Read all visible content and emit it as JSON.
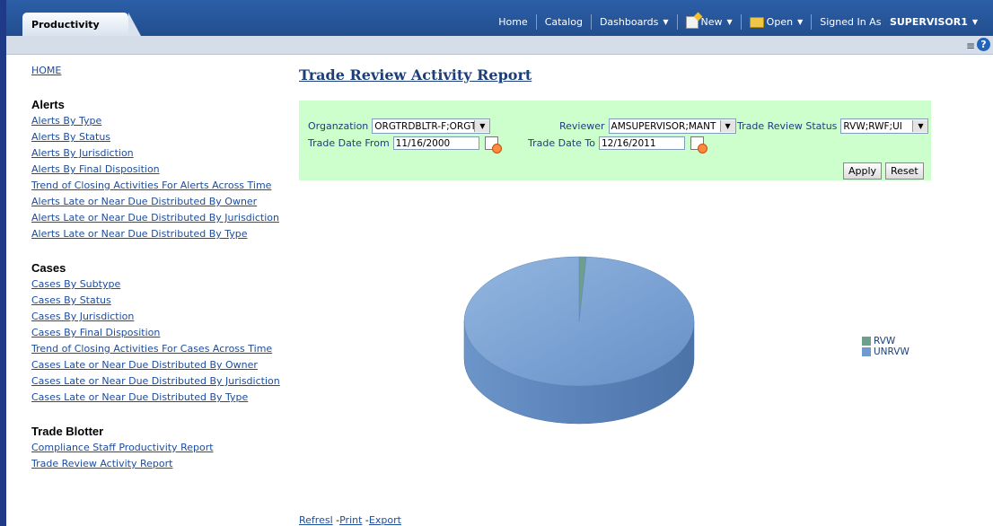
{
  "topbar": {
    "tab": "Productivity",
    "nav": {
      "home": "Home",
      "catalog": "Catalog",
      "dashboards": "Dashboards",
      "new": "New",
      "open": "Open",
      "signed_in_label": "Signed In As",
      "user": "SUPERVISOR1"
    }
  },
  "sidebar": {
    "home": "HOME",
    "sections": [
      {
        "title": "Alerts",
        "links": [
          "Alerts By Type",
          "Alerts By Status",
          "Alerts By Jurisdiction",
          "Alerts By Final Disposition",
          "Trend of Closing Activities For Alerts Across Time",
          "Alerts Late or Near Due Distributed By Owner",
          "Alerts Late or Near Due Distributed By Jurisdiction",
          "Alerts Late or Near Due Distributed By Type"
        ]
      },
      {
        "title": "Cases",
        "links": [
          "Cases By Subtype",
          "Cases By Status",
          "Cases By Jurisdiction",
          "Cases By Final Disposition",
          "Trend of Closing Activities For Cases Across Time",
          "Cases Late or Near Due Distributed By Owner",
          "Cases Late or Near Due Distributed By Jurisdiction",
          "Cases Late or Near Due Distributed By Type"
        ]
      },
      {
        "title": "Trade Blotter",
        "links": [
          "Compliance Staff Productivity Report",
          "Trade Review Activity Report"
        ]
      }
    ]
  },
  "report": {
    "title": "Trade Review Activity Report",
    "filters": {
      "organization_label": "Organzation",
      "organization_value": "ORGTRDBLTR-F;ORGT",
      "reviewer_label": "Reviewer",
      "reviewer_value": "AMSUPERVISOR;MANT",
      "status_label": "Trade Review Status",
      "status_value": "RVW;RWF;UI",
      "date_from_label": "Trade Date From",
      "date_from_value": "11/16/2000",
      "date_to_label": "Trade Date To",
      "date_to_value": "12/16/2011",
      "apply": "Apply",
      "reset": "Reset"
    },
    "footer": {
      "refresh": "Refresl",
      "print": "Print",
      "export": "Export"
    }
  },
  "chart_data": {
    "type": "pie",
    "series": [
      {
        "name": "RVW",
        "value": 1,
        "color": "#6e9e8c"
      },
      {
        "name": "UNRVW",
        "value": 99,
        "color": "#6f9ad1"
      }
    ]
  }
}
